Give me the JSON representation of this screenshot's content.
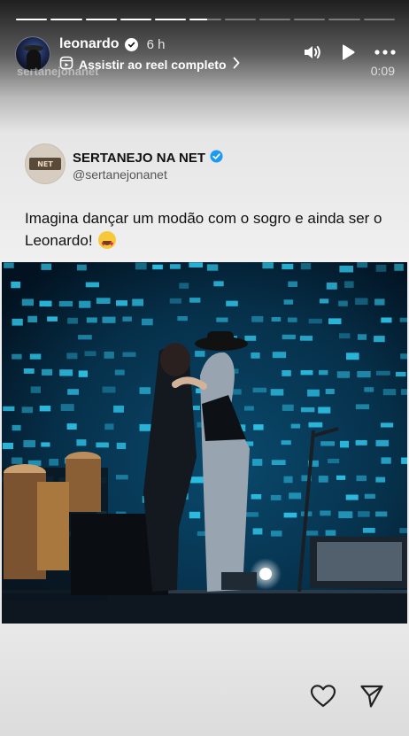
{
  "story": {
    "segments_total": 11,
    "segments_complete": 5,
    "current_segment_progress": 0.55
  },
  "header": {
    "username": "leonardo",
    "time_ago": "6 h",
    "reel_link": "Assistir ao reel completo",
    "watermark": "sertanejonanet",
    "duration": "0:09",
    "icons": [
      "volume-icon",
      "play-icon",
      "more-icon",
      "reel-icon",
      "chevron-right-icon",
      "verified-badge-icon"
    ]
  },
  "tweet": {
    "name": "SERTANEJO NA NET",
    "handle": "@sertanejonanet",
    "avatar_text": "NET",
    "text": "Imagina dançar um modão com o sogro e ainda ser o Leonardo!",
    "emoji": "smiling-face-with-heart-eyes"
  },
  "video": {
    "description": "video-frame"
  },
  "actions": {
    "icons": [
      "heart-icon",
      "share-icon"
    ]
  },
  "colors": {
    "accent_verified": "#1d9bf0",
    "stage_cyan": "#2ec3e8",
    "stage_dark": "#041a2b"
  }
}
